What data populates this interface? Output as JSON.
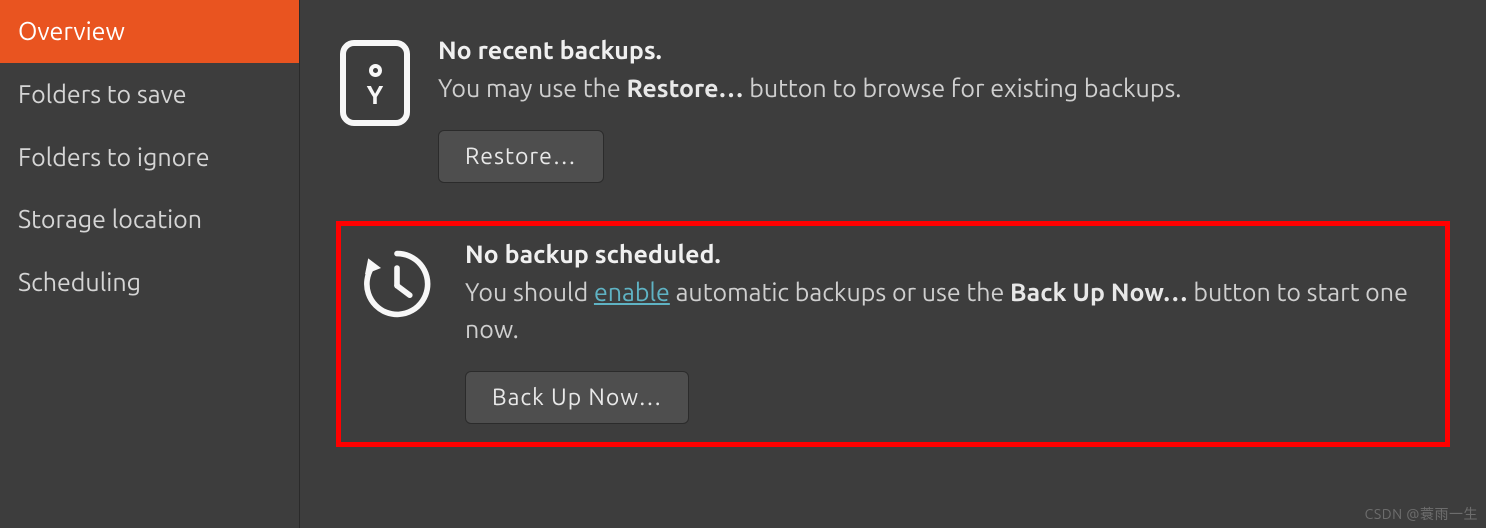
{
  "sidebar": {
    "items": [
      {
        "label": "Overview"
      },
      {
        "label": "Folders to save"
      },
      {
        "label": "Folders to ignore"
      },
      {
        "label": "Storage location"
      },
      {
        "label": "Scheduling"
      }
    ]
  },
  "restore_section": {
    "title": "No recent backups.",
    "desc_before": "You may use the ",
    "desc_strong": "Restore…",
    "desc_after": " button to browse for existing backups.",
    "button": "Restore…"
  },
  "backup_section": {
    "title": "No backup scheduled.",
    "desc_a": "You should ",
    "enable_link": "enable",
    "desc_b": " automatic backups or use the ",
    "desc_strong": "Back Up Now…",
    "desc_c": " button to start one now.",
    "button": "Back Up Now…"
  },
  "watermark": "CSDN @蓑雨一生"
}
